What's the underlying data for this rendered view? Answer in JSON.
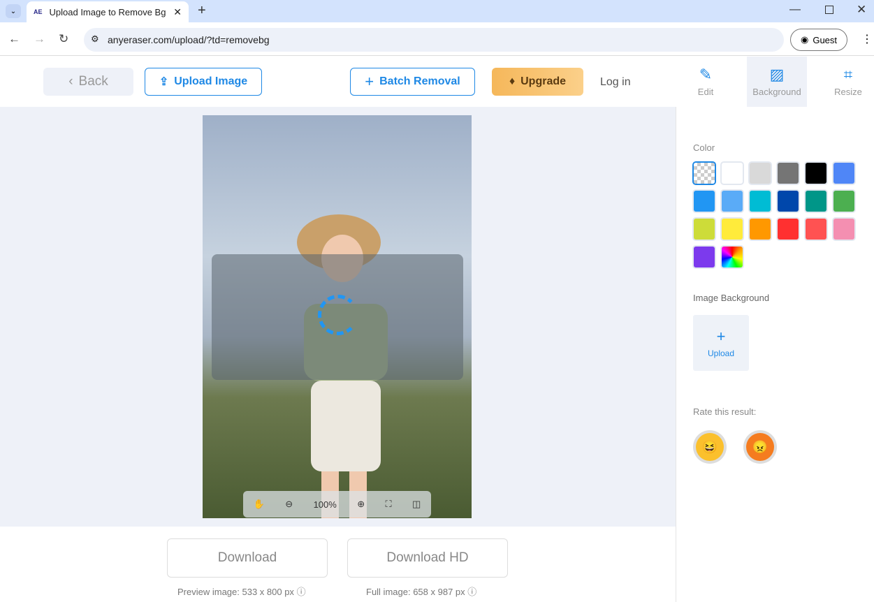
{
  "browser": {
    "tab_title": "Upload Image to Remove Bg",
    "tab_favicon": "AE",
    "url": "anyeraser.com/upload/?td=removebg",
    "profile": "Guest"
  },
  "toolbar": {
    "back": "Back",
    "upload": "Upload Image",
    "batch": "Batch Removal",
    "upgrade": "Upgrade",
    "login": "Log in",
    "tools": [
      {
        "label": "Edit",
        "icon": "edit-icon"
      },
      {
        "label": "Background",
        "icon": "background-icon",
        "active": true
      },
      {
        "label": "Resize",
        "icon": "crop-icon"
      }
    ]
  },
  "viewer": {
    "zoom": "100%"
  },
  "download": {
    "preview_label": "Download",
    "hd_label": "Download HD",
    "preview_caption": "Preview image: 533 x 800 px",
    "full_caption": "Full image: 658 x 987 px"
  },
  "sidebar": {
    "color_label": "Color",
    "colors": [
      "transparent",
      "#ffffff",
      "#d9d9d9",
      "#757575",
      "#000000",
      "#4f86f7",
      "#2196f3",
      "#5aabf7",
      "#00bcd4",
      "#0047ab",
      "#009688",
      "#4caf50",
      "#cddc39",
      "#ffeb3b",
      "#ff9800",
      "#ff3030",
      "#ff5252",
      "#f48fb1",
      "#7c3aed",
      "rainbow"
    ],
    "selected_color": "transparent",
    "image_bg_label": "Image Background",
    "upload_label": "Upload",
    "rate_label": "Rate this result:"
  },
  "accent": "#1e88e5"
}
